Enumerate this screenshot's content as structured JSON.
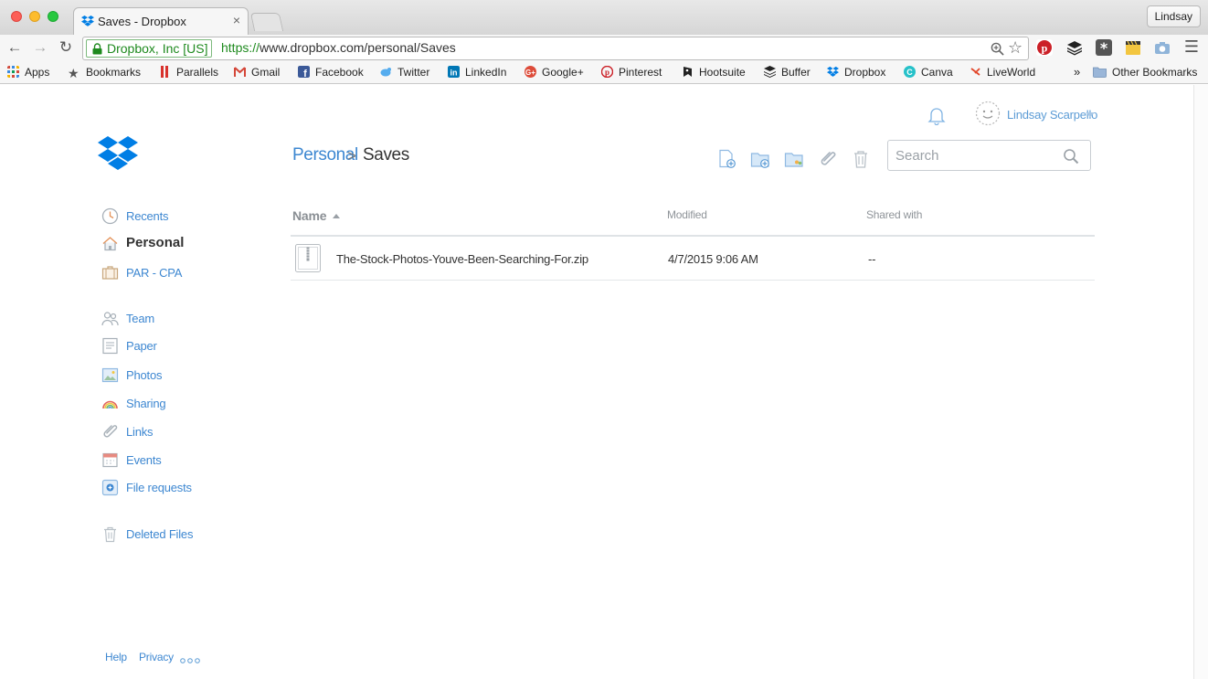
{
  "browser": {
    "tab_title": "Saves - Dropbox",
    "tab_close": "×",
    "profile": "Lindsay",
    "ev_cert": "Dropbox, Inc [US]",
    "url_scheme": "https://",
    "url_rest": "www.dropbox.com/personal/Saves",
    "bookmarks": [
      "Apps",
      "Bookmarks",
      "Parallels",
      "Gmail",
      "Facebook",
      "Twitter",
      "LinkedIn",
      "Google+",
      "Pinterest",
      "Hootsuite",
      "Buffer",
      "Dropbox",
      "Canva",
      "LiveWorld"
    ],
    "overflow": "»",
    "other_bookmarks": "Other Bookmarks"
  },
  "header": {
    "user_name": "Lindsay Scarpello"
  },
  "breadcrumb": {
    "parent": "Personal",
    "separator": ">",
    "current": "Saves"
  },
  "search": {
    "placeholder": "Search"
  },
  "sidebar": {
    "items": [
      {
        "label": "Recents"
      },
      {
        "label": "Personal"
      },
      {
        "label": "PAR - CPA"
      },
      {
        "label": "Team"
      },
      {
        "label": "Paper"
      },
      {
        "label": "Photos"
      },
      {
        "label": "Sharing"
      },
      {
        "label": "Links"
      },
      {
        "label": "Events"
      },
      {
        "label": "File requests"
      },
      {
        "label": "Deleted Files"
      }
    ]
  },
  "table": {
    "columns": [
      "Name",
      "Modified",
      "Shared with"
    ],
    "rows": [
      {
        "name": "The-Stock-Photos-Youve-Been-Searching-For.zip",
        "modified": "4/7/2015 9:06 AM",
        "shared": "--"
      }
    ]
  },
  "footer": {
    "help": "Help",
    "privacy": "Privacy"
  },
  "colors": {
    "link_blue": "#3d87d1",
    "dropbox_blue": "#007ee5"
  }
}
